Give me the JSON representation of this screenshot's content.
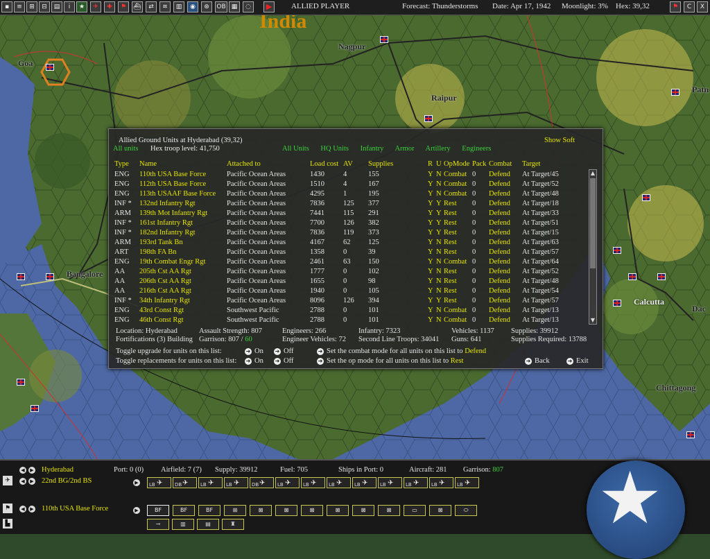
{
  "topbar": {
    "player": "ALLIED PLAYER",
    "forecast": "Forecast: Thunderstorms",
    "date": "Date: Apr 17, 1942",
    "moonlight": "Moonlight: 3%",
    "hex": "Hex: 39,32",
    "buttons": [
      "OB",
      "C",
      "X"
    ]
  },
  "map": {
    "region_label": "India",
    "cities": {
      "goa": "Goa",
      "nagpur": "Nagpur",
      "raipur": "Raipur",
      "bangalore": "Bangalore",
      "calcutta": "Calcutta",
      "chittagong": "Chittagong",
      "patna": "Patn",
      "dacca": "Dac"
    }
  },
  "dialog": {
    "title": "Allied Ground Units at Hyderabad (39,32)",
    "show_soft": "Show Soft",
    "all_units_top": "All units",
    "hex_troop": "Hex troop level: 41,750",
    "filters": [
      "All Units",
      "HQ Units",
      "Infantry",
      "Armor",
      "Artillery",
      "Engineers"
    ],
    "headers": {
      "type": "Type",
      "name": "Name",
      "attached": "Attached to",
      "load": "Load cost",
      "av": "AV",
      "supplies": "Supplies",
      "r": "R",
      "u": "U",
      "opmode": "OpMode",
      "pack": "Pack",
      "combat": "Combat",
      "target": "Target"
    },
    "units": [
      {
        "type": "ENG",
        "name": "110th USA Base Force",
        "attached": "Pacific Ocean Areas",
        "load": "1430",
        "av": "4",
        "sup": "155",
        "r": "Y",
        "u": "N",
        "op": "Combat",
        "pack": "0",
        "cmb": "Defend",
        "tgt": "At Target/45"
      },
      {
        "type": "ENG",
        "name": "112th USA Base Force",
        "attached": "Pacific Ocean Areas",
        "load": "1510",
        "av": "4",
        "sup": "167",
        "r": "Y",
        "u": "N",
        "op": "Combat",
        "pack": "0",
        "cmb": "Defend",
        "tgt": "At Target/52"
      },
      {
        "type": "ENG",
        "name": "113th USAAF Base Force",
        "attached": "Pacific Ocean Areas",
        "load": "4295",
        "av": "1",
        "sup": "195",
        "r": "Y",
        "u": "N",
        "op": "Combat",
        "pack": "0",
        "cmb": "Defend",
        "tgt": "At Target/48"
      },
      {
        "type": "INF *",
        "name": "132nd Infantry Rgt",
        "attached": "Pacific Ocean Areas",
        "load": "7836",
        "av": "125",
        "sup": "377",
        "r": "Y",
        "u": "Y",
        "op": "Rest",
        "pack": "0",
        "cmb": "Defend",
        "tgt": "At Target/18"
      },
      {
        "type": "ARM",
        "name": "139th Mot Infantry Rgt",
        "attached": "Pacific Ocean Areas",
        "load": "7441",
        "av": "115",
        "sup": "291",
        "r": "Y",
        "u": "Y",
        "op": "Rest",
        "pack": "0",
        "cmb": "Defend",
        "tgt": "At Target/33"
      },
      {
        "type": "INF *",
        "name": "161st Infantry Rgt",
        "attached": "Pacific Ocean Areas",
        "load": "7700",
        "av": "126",
        "sup": "382",
        "r": "Y",
        "u": "Y",
        "op": "Rest",
        "pack": "0",
        "cmb": "Defend",
        "tgt": "At Target/51"
      },
      {
        "type": "INF *",
        "name": "182nd Infantry Rgt",
        "attached": "Pacific Ocean Areas",
        "load": "7836",
        "av": "119",
        "sup": "373",
        "r": "Y",
        "u": "Y",
        "op": "Rest",
        "pack": "0",
        "cmb": "Defend",
        "tgt": "At Target/15"
      },
      {
        "type": "ARM",
        "name": "193rd Tank Bn",
        "attached": "Pacific Ocean Areas",
        "load": "4167",
        "av": "62",
        "sup": "125",
        "r": "Y",
        "u": "N",
        "op": "Rest",
        "pack": "0",
        "cmb": "Defend",
        "tgt": "At Target/63"
      },
      {
        "type": "ART",
        "name": "198th FA Bn",
        "attached": "Pacific Ocean Areas",
        "load": "1358",
        "av": "0",
        "sup": "39",
        "r": "Y",
        "u": "N",
        "op": "Rest",
        "pack": "0",
        "cmb": "Defend",
        "tgt": "At Target/57"
      },
      {
        "type": "ENG",
        "name": "19th Combat Engr Rgt",
        "attached": "Pacific Ocean Areas",
        "load": "2461",
        "av": "63",
        "sup": "150",
        "r": "Y",
        "u": "N",
        "op": "Combat",
        "pack": "0",
        "cmb": "Defend",
        "tgt": "At Target/64"
      },
      {
        "type": "AA",
        "name": "205th Cst AA Rgt",
        "attached": "Pacific Ocean Areas",
        "load": "1777",
        "av": "0",
        "sup": "102",
        "r": "Y",
        "u": "N",
        "op": "Rest",
        "pack": "0",
        "cmb": "Defend",
        "tgt": "At Target/52"
      },
      {
        "type": "AA",
        "name": "206th Cst AA Rgt",
        "attached": "Pacific Ocean Areas",
        "load": "1655",
        "av": "0",
        "sup": "98",
        "r": "Y",
        "u": "N",
        "op": "Rest",
        "pack": "0",
        "cmb": "Defend",
        "tgt": "At Target/48"
      },
      {
        "type": "AA",
        "name": "216th Cst AA Rgt",
        "attached": "Pacific Ocean Areas",
        "load": "1940",
        "av": "0",
        "sup": "105",
        "r": "Y",
        "u": "N",
        "op": "Rest",
        "pack": "0",
        "cmb": "Defend",
        "tgt": "At Target/54"
      },
      {
        "type": "INF *",
        "name": "34th Infantry Rgt",
        "attached": "Pacific Ocean Areas",
        "load": "8096",
        "av": "126",
        "sup": "394",
        "r": "Y",
        "u": "Y",
        "op": "Rest",
        "pack": "0",
        "cmb": "Defend",
        "tgt": "At Target/57"
      },
      {
        "type": "ENG",
        "name": "43rd Const Rgt",
        "attached": "Southwest Pacific",
        "load": "2788",
        "av": "0",
        "sup": "101",
        "r": "Y",
        "u": "N",
        "op": "Combat",
        "pack": "0",
        "cmb": "Defend",
        "tgt": "At Target/13"
      },
      {
        "type": "ENG",
        "name": "46th Const Rgt",
        "attached": "Southwest Pacific",
        "load": "2788",
        "av": "0",
        "sup": "101",
        "r": "Y",
        "u": "N",
        "op": "Combat",
        "pack": "0",
        "cmb": "Defend",
        "tgt": "At Target/13"
      }
    ],
    "summary": {
      "location": "Location: Hyderabad",
      "assault": "Assault Strength: 807",
      "engineers": "Engineers: 266",
      "infantry": "Infantry: 7323",
      "vehicles": "Vehicles: 1137",
      "supplies": "Supplies: 39912",
      "fortifications": "Fortifications (3) Building",
      "garrison_label": "Garrison: 807 / ",
      "garrison_val": "60",
      "eng_vehicles": "Engineer Vehicles: 72",
      "second_line": "Second Line Troops: 34041",
      "guns": "Guns: 641",
      "supplies_req": "Supplies Required: 13788"
    },
    "controls": {
      "toggle_upgrade": "Toggle upgrade for units on this list:",
      "toggle_replace": "Toggle replacements for units on this list:",
      "on": "On",
      "off": "Off",
      "set_combat": "Set the combat mode for all units on this list to",
      "combat_val": "Defend",
      "set_op": "Set the op mode for all units on this list to",
      "op_val": "Rest",
      "back": "Back",
      "exit": "Exit"
    }
  },
  "bottom": {
    "base_name": "Hyderabad",
    "port": "Port: 0 (0)",
    "airfield": "Airfield: 7 (7)",
    "supply": "Supply: 39912",
    "fuel": "Fuel: 705",
    "ships": "Ships in Port: 0",
    "aircraft": "Aircraft: 281",
    "garrison_label": "Garrison: ",
    "garrison_val": "807",
    "air_unit": "22nd BG/2nd BS",
    "land_unit": "110th USA Base Force",
    "air_slots": [
      "LB",
      "DB",
      "LB",
      "LB",
      "DB",
      "LB",
      "LB",
      "LB",
      "LB",
      "LB",
      "LB",
      "LB",
      "LB"
    ],
    "land_slots": [
      "BF",
      "BF",
      "BF",
      "",
      "",
      "",
      "",
      "",
      "",
      "",
      "",
      "",
      ""
    ]
  },
  "colors": {
    "accent_yellow": "#e6e600",
    "accent_green": "#3ad23a",
    "dialog_bg": "#282828",
    "sea": "#4e6aa8"
  }
}
